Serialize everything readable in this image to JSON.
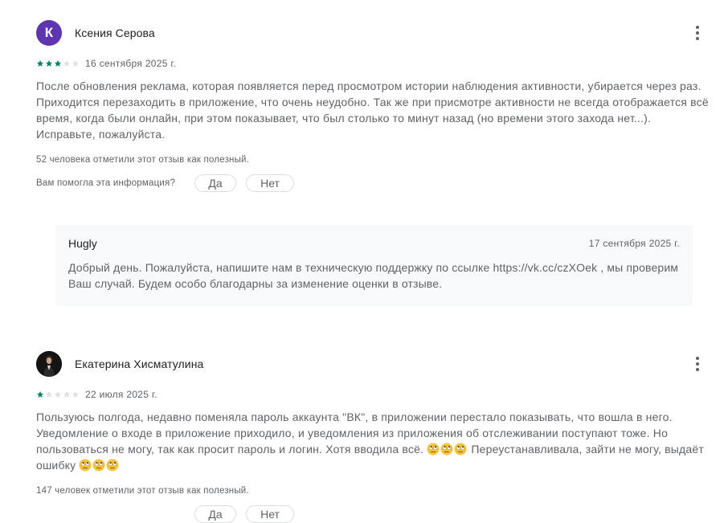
{
  "reviews": [
    {
      "avatar_letter": "К",
      "author": "Ксения Серова",
      "rating": 3,
      "date": "16 сентября 2025 г.",
      "text": "После обновления реклама, которая появляется перед просмотром истории наблюдения активности, убирается через раз. Приходится перезаходить в приложение, что очень неудобно. Так же при присмотре активности не всегда отображается всё время, когда были онлайн, при этом показывает, что был столько то минут назад (но времени этого захода нет...). Исправьте, пожалуйста.",
      "helpful_count": "52 человека отметили этот отзыв как полезный.",
      "helpful_question": "Вам помогла эта информация?",
      "yes_label": "Да",
      "no_label": "Нет",
      "reply": {
        "author": "Hugly",
        "date": "17 сентября 2025 г.",
        "text": "Добрый день. Пожалуйста, напишите нам в техническую поддержку по ссылке https://vk.cc/czXOek , мы проверим Ваш случай. Будем особо благодарны за изменение оценки в отзыве."
      }
    },
    {
      "author": "Екатерина Хисматулина",
      "rating": 1,
      "date": "22 июля 2025 г.",
      "text_part1": "Пользуюсь полгода, недавно поменяла пароль аккаунта \"ВК\", в приложении перестало показывать, что вошла в него. Уведомление о входе в приложение приходило, и уведомления из приложения об отслеживании поступают тоже. Но пользоваться не могу, так как просит пароль и логин. Хотя вводила всё. ",
      "text_part2": " Переустанавливала, зайти не могу, выдаёт ошибку ",
      "emoji_name": "face-with-rolling-eyes-emoji",
      "helpful_count": "147 человек отметили этот отзыв как полезный."
    }
  ],
  "colors": {
    "star_on": "#01875f",
    "star_off": "#e0e0e0",
    "avatar_letter_bg": "#5e35b1",
    "reply_bg": "#f8f9fa"
  },
  "icons": {
    "more": "more-vert-icon",
    "star": "star-icon",
    "emoji": "face-with-rolling-eyes-emoji"
  }
}
